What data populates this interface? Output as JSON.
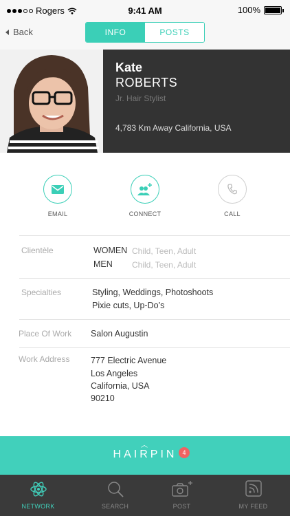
{
  "status_bar": {
    "carrier": "Rogers",
    "time": "9:41 AM",
    "battery": "100%"
  },
  "nav": {
    "back_label": "Back",
    "tabs": [
      {
        "label": "INFO",
        "active": true
      },
      {
        "label": "POSTS",
        "active": false
      }
    ]
  },
  "profile": {
    "first_name": "Kate",
    "last_name": "ROBERTS",
    "role": "Jr. Hair Stylist",
    "location": "4,783 Km Away California, USA"
  },
  "actions": [
    {
      "label": "EMAIL",
      "icon": "envelope-icon"
    },
    {
      "label": "CONNECT",
      "icon": "add-people-icon"
    },
    {
      "label": "CALL",
      "icon": "phone-icon"
    }
  ],
  "details": {
    "clientele": {
      "label": "Clientèle",
      "women_label": "WOMEN",
      "women_value": "Child, Teen, Adult",
      "men_label": "MEN",
      "men_value": "Child, Teen, Adult"
    },
    "specialties": {
      "label": "Specialties",
      "line1": "Styling, Weddings, Photoshoots",
      "line2": "Pixie cuts, Up-Do’s"
    },
    "place_of_work": {
      "label": "Place Of Work",
      "value": "Salon Augustin"
    },
    "work_address": {
      "label": "Work Address",
      "line1": "777 Electric Avenue",
      "line2": "Los Angeles",
      "line3": "California, USA",
      "line4": "90210"
    }
  },
  "brand": {
    "name": "HAIRPIN",
    "badge_count": "4"
  },
  "tab_bar": [
    {
      "label": "NETWORK",
      "icon": "atom-icon",
      "active": true
    },
    {
      "label": "SEARCH",
      "icon": "search-icon",
      "active": false
    },
    {
      "label": "POST",
      "icon": "camera-plus-icon",
      "active": false
    },
    {
      "label": "MY FEED",
      "icon": "rss-icon",
      "active": false
    }
  ],
  "colors": {
    "accent": "#41d0bb",
    "dark": "#333333",
    "badge": "#f06262"
  }
}
